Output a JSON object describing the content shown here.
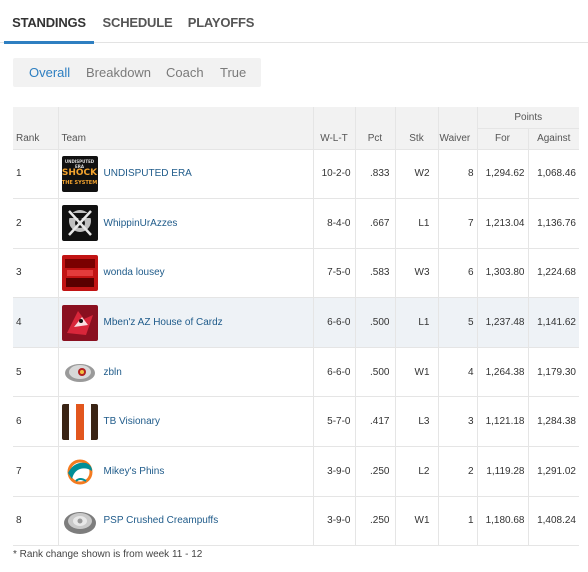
{
  "tabs": [
    {
      "label": "STANDINGS",
      "active": true
    },
    {
      "label": "SCHEDULE",
      "active": false
    },
    {
      "label": "PLAYOFFS",
      "active": false
    }
  ],
  "subtabs": [
    {
      "label": "Overall",
      "active": true
    },
    {
      "label": "Breakdown",
      "active": false
    },
    {
      "label": "Coach",
      "active": false
    },
    {
      "label": "True",
      "active": false
    }
  ],
  "table": {
    "group_header": "Points",
    "columns": [
      "Rank",
      "Team",
      "W-L-T",
      "Pct",
      "Stk",
      "Waiver",
      "For",
      "Against"
    ],
    "rows": [
      {
        "rank": "1",
        "team": "UNDISPUTED ERA",
        "wlt": "10-2-0",
        "pct": ".833",
        "stk": "W2",
        "waiver": "8",
        "for": "1,294.62",
        "against": "1,068.46",
        "logo": "undisputed-era-logo",
        "logo_text": [
          "UNDISPUTED ERA",
          "SHOCK",
          "THE SYSTEM"
        ]
      },
      {
        "rank": "2",
        "team": "WhippinUrAzzes",
        "wlt": "8-4-0",
        "pct": ".667",
        "stk": "L1",
        "waiver": "7",
        "for": "1,213.04",
        "against": "1,136.76",
        "logo": "raiders-logo"
      },
      {
        "rank": "3",
        "team": "wonda lousey",
        "wlt": "7-5-0",
        "pct": ".583",
        "stk": "W3",
        "waiver": "6",
        "for": "1,303.80",
        "against": "1,224.68",
        "logo": "red-text-logo"
      },
      {
        "rank": "4",
        "team": "Mben'z AZ House of Cardz",
        "wlt": "6-6-0",
        "pct": ".500",
        "stk": "L1",
        "waiver": "5",
        "for": "1,237.48",
        "against": "1,141.62",
        "logo": "cardinals-logo",
        "highlight": true
      },
      {
        "rank": "5",
        "team": "zbln",
        "wlt": "6-6-0",
        "pct": ".500",
        "stk": "W1",
        "waiver": "4",
        "for": "1,264.38",
        "against": "1,179.30",
        "logo": "ring-logo"
      },
      {
        "rank": "6",
        "team": "TB Visionary",
        "wlt": "5-7-0",
        "pct": ".417",
        "stk": "L3",
        "waiver": "3",
        "for": "1,121.18",
        "against": "1,284.38",
        "logo": "browns-stripes-logo"
      },
      {
        "rank": "7",
        "team": "Mikey's Phins",
        "wlt": "3-9-0",
        "pct": ".250",
        "stk": "L2",
        "waiver": "2",
        "for": "1,119.28",
        "against": "1,291.02",
        "logo": "dolphins-logo"
      },
      {
        "rank": "8",
        "team": "PSP Crushed Creampuffs",
        "wlt": "3-9-0",
        "pct": ".250",
        "stk": "W1",
        "waiver": "1",
        "for": "1,180.68",
        "against": "1,408.24",
        "logo": "championship-ring-logo"
      }
    ]
  },
  "footnote": "* Rank change shown is from week 11 - 12",
  "colors": {
    "accent": "#2e7fc1",
    "link": "#1f5b8a",
    "header_bg": "#f2f2f2",
    "highlight_row": "#eef2f6"
  }
}
